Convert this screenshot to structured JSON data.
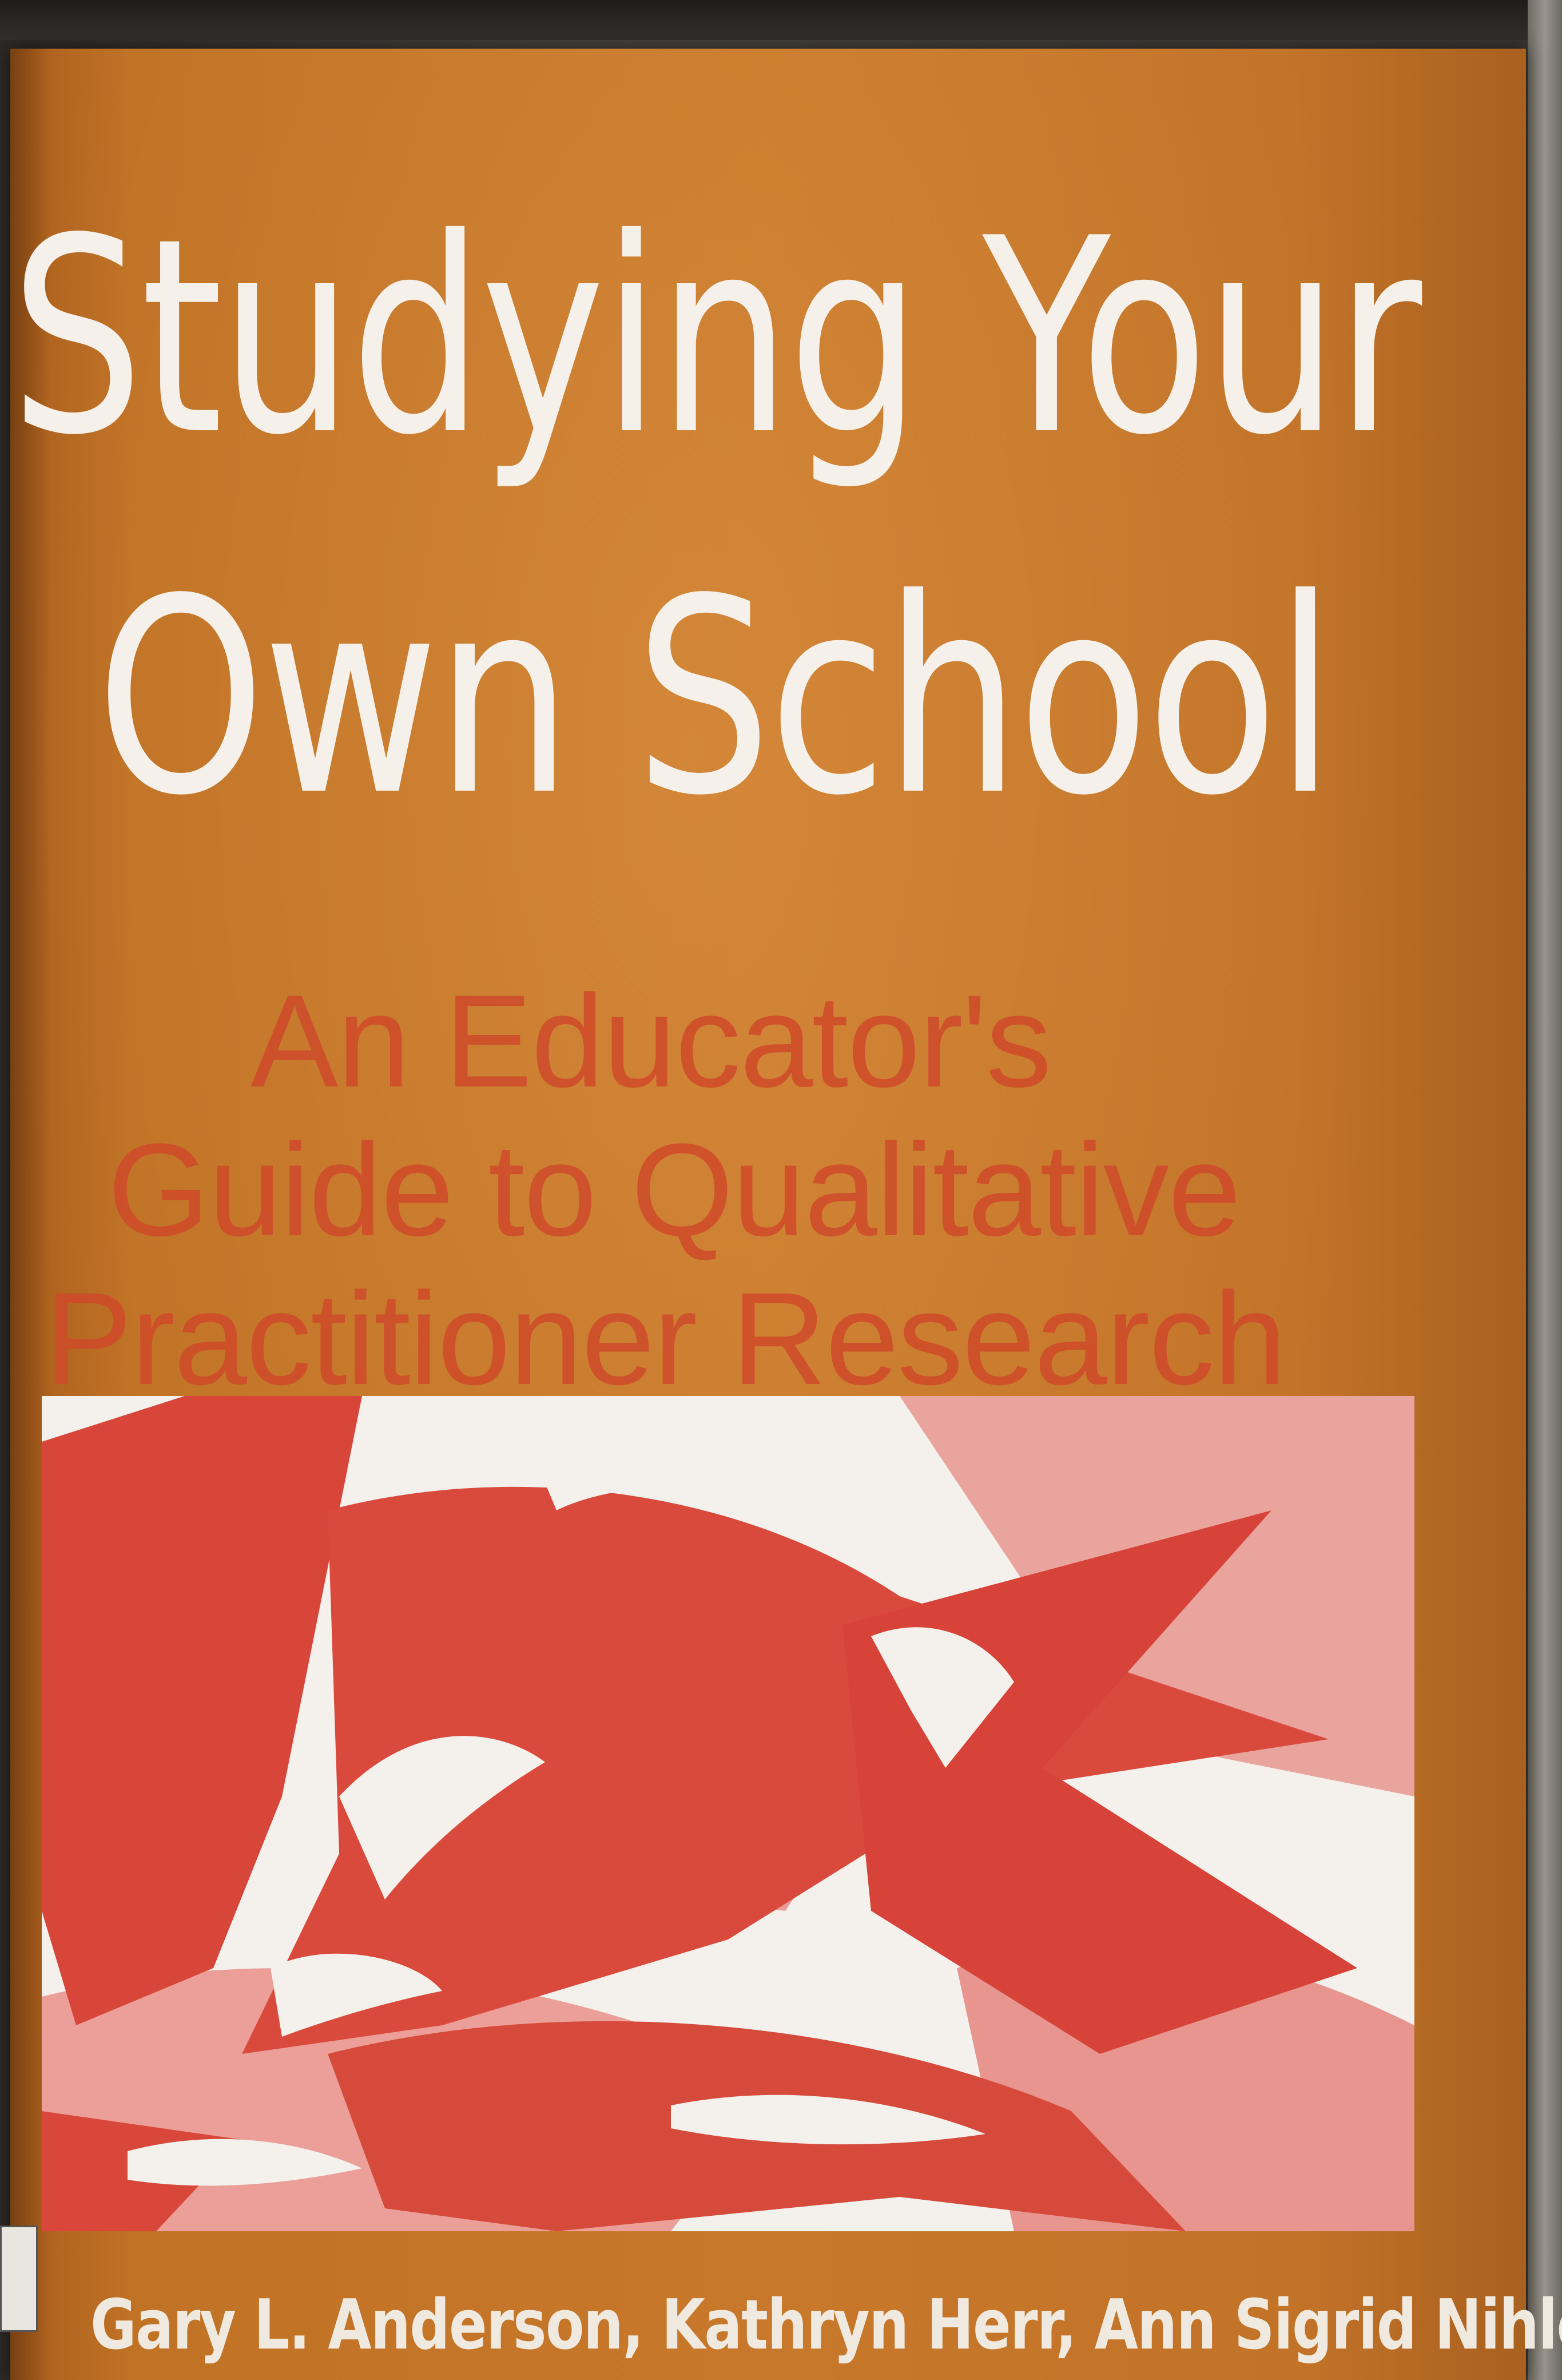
{
  "book": {
    "title_line_1": "Studying Your",
    "title_line_2": "Own School",
    "subtitle_line_1": "An Educator's",
    "subtitle_line_2": "Guide to Qualitative",
    "subtitle_line_3": "Practitioner Research",
    "authors": "Gary L. Anderson, Kathryn Herr, Ann Sigrid Nihlen"
  },
  "colors": {
    "cover": "#c8782a",
    "title": "#f5f1ea",
    "subtitle": "#cf4a2a",
    "art_dark": "#d9473a",
    "art_light": "#e88a85",
    "art_bg": "#f4f0ec"
  }
}
